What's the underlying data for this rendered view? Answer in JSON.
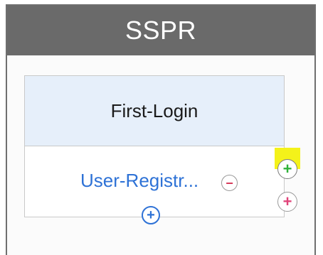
{
  "panel": {
    "title": "SSPR"
  },
  "card": {
    "title": "First-Login",
    "link_text": "User-Registr...",
    "remove_symbol": "−",
    "add_below_symbol": "+"
  },
  "side_actions": {
    "add_green_symbol": "+",
    "add_pink_symbol": "+"
  },
  "colors": {
    "header_bg": "#6a6a6a",
    "card_header_bg": "#e6effa",
    "link": "#2e72d6",
    "highlight": "#f4f21a",
    "green_plus": "#2fb23a",
    "pink_plus": "#e0447a",
    "minus": "#d63a5a"
  },
  "icons": [
    "minus-circle-icon",
    "plus-circle-icon"
  ]
}
